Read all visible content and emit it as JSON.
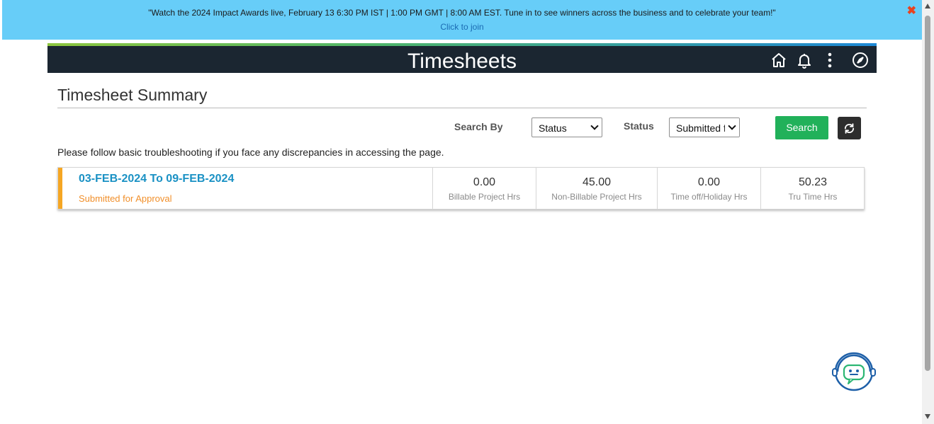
{
  "banner": {
    "message": "\"Watch the 2024 Impact Awards live, February 13 6:30 PM IST | 1:00 PM GMT | 8:00 AM EST. Tune in to see winners across the business and to celebrate your team!\"",
    "link_label": "Click to join",
    "close_glyph": "✖"
  },
  "header": {
    "title": "Timesheets",
    "icons": [
      "home-icon",
      "bell-icon",
      "more-vertical-icon",
      "compass-icon"
    ]
  },
  "summary": {
    "title": "Timesheet Summary",
    "search_by_label": "Search By",
    "search_by_value": "Status",
    "status_label": "Status",
    "status_value": "Submitted f",
    "search_button": "Search",
    "refresh_icon": "refresh-icon",
    "info_text": "Please follow basic troubleshooting if you face any discrepancies in accessing the page."
  },
  "timesheets": [
    {
      "period": "03-FEB-2024 To 09-FEB-2024",
      "status": "Submitted for Approval",
      "stats": [
        {
          "value": "0.00",
          "label": "Billable Project Hrs"
        },
        {
          "value": "45.00",
          "label": "Non-Billable Project Hrs"
        },
        {
          "value": "0.00",
          "label": "Time off/Holiday Hrs"
        },
        {
          "value": "50.23",
          "label": "Tru Time Hrs"
        }
      ]
    }
  ],
  "colors": {
    "banner": "#67cdf8",
    "header": "#1b2631",
    "accent_green": "#21b15a",
    "period_link": "#1a91c4",
    "status_orange": "#f18f2a",
    "card_accent": "#f5a623"
  },
  "chatbot_icon": "chatbot-icon"
}
